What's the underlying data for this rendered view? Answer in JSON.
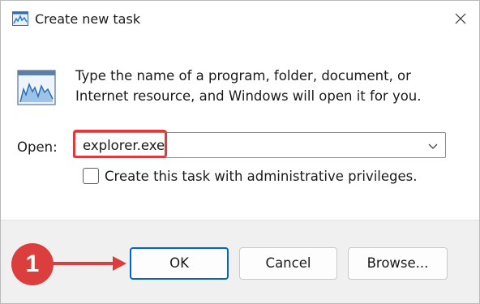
{
  "window": {
    "title": "Create new task"
  },
  "description": "Type the name of a program, folder, document, or Internet resource, and Windows will open it for you.",
  "open_field": {
    "label": "Open:",
    "value": "explorer.exe"
  },
  "admin_checkbox": {
    "label": "Create this task with administrative privileges.",
    "checked": false
  },
  "buttons": {
    "ok": "OK",
    "cancel": "Cancel",
    "browse": "Browse..."
  },
  "annotation": {
    "step_number": "1",
    "color": "#dc3e3e"
  },
  "icons": {
    "title": "task-manager-icon",
    "main": "task-manager-icon",
    "close": "close-icon",
    "dropdown": "chevron-down-icon"
  },
  "colors": {
    "accent": "#0067c0",
    "highlight": "#e0383b",
    "footer_bg": "#f0f0f0"
  }
}
